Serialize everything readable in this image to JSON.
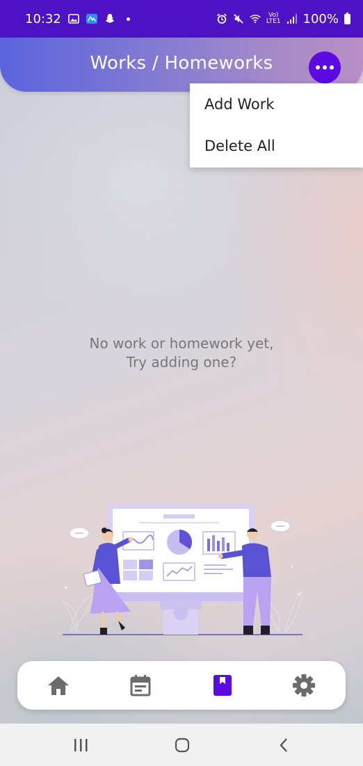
{
  "status_bar": {
    "time": "10:32",
    "battery": "100%",
    "left_icons": [
      "gallery-icon",
      "app-icon",
      "snapchat-icon",
      "dot-icon"
    ],
    "right_icons": [
      "alarm-icon",
      "mute-icon",
      "wifi-icon",
      "volte-lte1-icon",
      "signal-icon",
      "battery-icon"
    ]
  },
  "header": {
    "title": "Works / Homeworks",
    "more_icon": "more-horizontal-icon"
  },
  "menu": {
    "items": [
      {
        "label": "Add Work"
      },
      {
        "label": "Delete All"
      }
    ]
  },
  "empty_state": {
    "line1": "No work or homework yet,",
    "line2": "Try adding one?"
  },
  "bottom_nav": {
    "items": [
      {
        "icon": "home-icon",
        "active": false
      },
      {
        "icon": "calendar-icon",
        "active": false
      },
      {
        "icon": "book-icon",
        "active": true
      },
      {
        "icon": "settings-gear-icon",
        "active": false
      }
    ],
    "active_color": "#5b0be0",
    "inactive_color": "#6b6b6b"
  },
  "colors": {
    "status_bar": "#4c12c4",
    "accent": "#5b0be0"
  }
}
